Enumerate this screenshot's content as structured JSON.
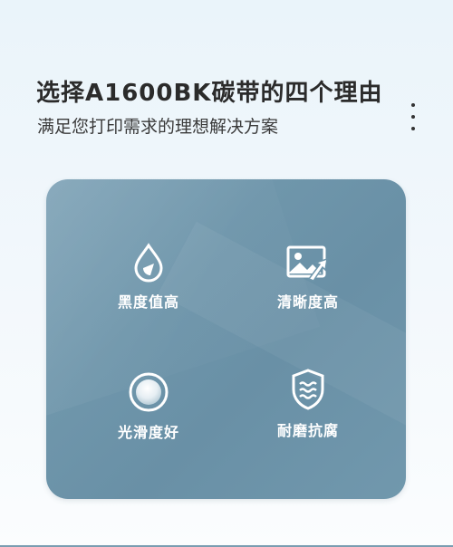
{
  "header": {
    "title": "选择A1600BK碳带的四个理由",
    "subtitle": "满足您打印需求的理想解决方案",
    "more_icon": "more-vertical-icon"
  },
  "features": [
    {
      "label": "黑度值高",
      "icon": "ink-drop-icon"
    },
    {
      "label": "清晰度高",
      "icon": "image-clarity-icon"
    },
    {
      "label": "光滑度好",
      "icon": "smooth-sphere-icon"
    },
    {
      "label": "耐磨抗腐",
      "icon": "shield-wave-icon"
    }
  ],
  "colors": {
    "card": "#6f96ab",
    "text_primary": "#2b2b2b",
    "feature_text": "#ffffff"
  }
}
